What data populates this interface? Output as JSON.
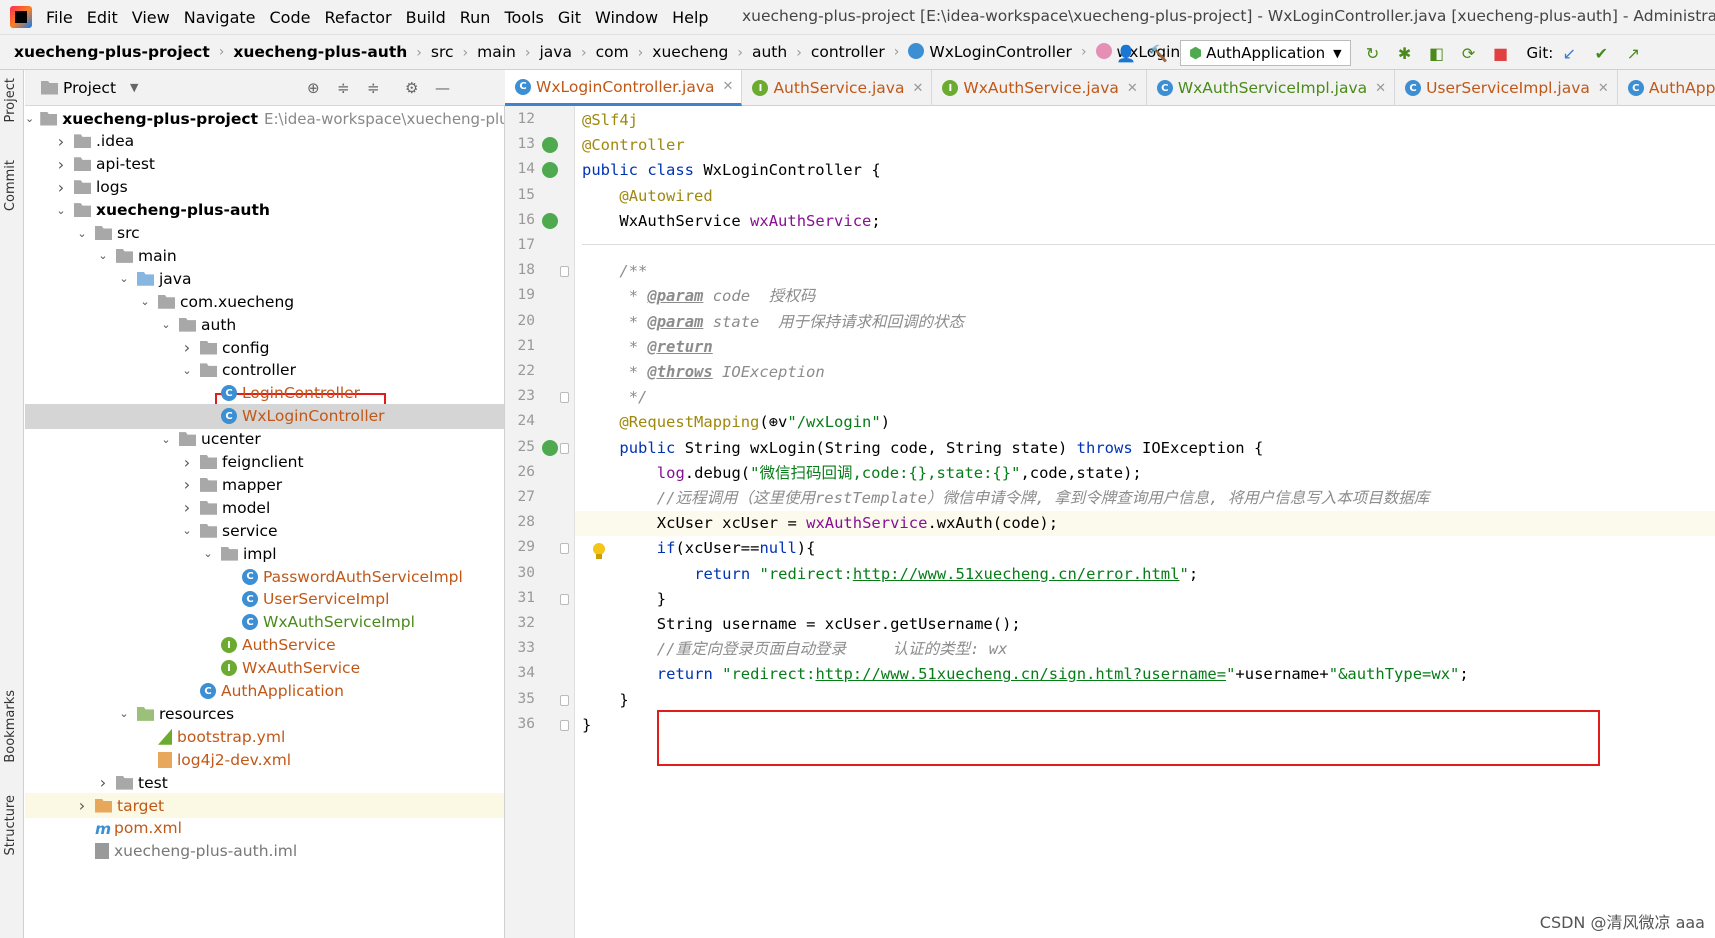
{
  "menu": [
    "File",
    "Edit",
    "View",
    "Navigate",
    "Code",
    "Refactor",
    "Build",
    "Run",
    "Tools",
    "Git",
    "Window",
    "Help"
  ],
  "window_title": "xuecheng-plus-project [E:\\idea-workspace\\xuecheng-plus-project] - WxLoginController.java [xuecheng-plus-auth] - Administrator",
  "breadcrumb": {
    "project": "xuecheng-plus-project",
    "module": "xuecheng-plus-auth",
    "path": [
      "src",
      "main",
      "java",
      "com",
      "xuecheng",
      "auth",
      "controller"
    ],
    "class": "WxLoginController",
    "method": "wxLogin"
  },
  "toolbar": {
    "run_config": "AuthApplication",
    "git_label": "Git:"
  },
  "side_tabs": {
    "project": "Project",
    "commit": "Commit",
    "bookmarks": "Bookmarks",
    "structure": "Structure"
  },
  "project_panel": {
    "title": "Project"
  },
  "tree": [
    {
      "label": "xuecheng-plus-project",
      "path": "E:\\idea-workspace\\xuecheng-plu",
      "depth": 0,
      "chev": "v",
      "icon": "folder",
      "style": "bold"
    },
    {
      "label": ".idea",
      "depth": 1,
      "chev": ">",
      "icon": "folder"
    },
    {
      "label": "api-test",
      "depth": 1,
      "chev": ">",
      "icon": "folder"
    },
    {
      "label": "logs",
      "depth": 1,
      "chev": ">",
      "icon": "folder"
    },
    {
      "label": "xuecheng-plus-auth",
      "depth": 1,
      "chev": "v",
      "icon": "folder",
      "style": "bold"
    },
    {
      "label": "src",
      "depth": 2,
      "chev": "v",
      "icon": "folder"
    },
    {
      "label": "main",
      "depth": 3,
      "chev": "v",
      "icon": "folder"
    },
    {
      "label": "java",
      "depth": 4,
      "chev": "v",
      "icon": "folder-blue"
    },
    {
      "label": "com.xuecheng",
      "depth": 5,
      "chev": "v",
      "icon": "folder"
    },
    {
      "label": "auth",
      "depth": 6,
      "chev": "v",
      "icon": "folder"
    },
    {
      "label": "config",
      "depth": 7,
      "chev": ">",
      "icon": "folder"
    },
    {
      "label": "controller",
      "depth": 7,
      "chev": "v",
      "icon": "folder"
    },
    {
      "label": "LoginController",
      "depth": 8,
      "chev": "",
      "icon": "class",
      "style": "orange"
    },
    {
      "label": "WxLoginController",
      "depth": 8,
      "chev": "",
      "icon": "class",
      "style": "orange",
      "selected": true
    },
    {
      "label": "ucenter",
      "depth": 6,
      "chev": "v",
      "icon": "folder"
    },
    {
      "label": "feignclient",
      "depth": 7,
      "chev": ">",
      "icon": "folder"
    },
    {
      "label": "mapper",
      "depth": 7,
      "chev": ">",
      "icon": "folder"
    },
    {
      "label": "model",
      "depth": 7,
      "chev": ">",
      "icon": "folder"
    },
    {
      "label": "service",
      "depth": 7,
      "chev": "v",
      "icon": "folder"
    },
    {
      "label": "impl",
      "depth": 8,
      "chev": "v",
      "icon": "folder"
    },
    {
      "label": "PasswordAuthServiceImpl",
      "depth": 9,
      "chev": "",
      "icon": "class",
      "style": "orange"
    },
    {
      "label": "UserServiceImpl",
      "depth": 9,
      "chev": "",
      "icon": "class",
      "style": "orange"
    },
    {
      "label": "WxAuthServiceImpl",
      "depth": 9,
      "chev": "",
      "icon": "class",
      "style": "green"
    },
    {
      "label": "AuthService",
      "depth": 8,
      "chev": "",
      "icon": "interface",
      "style": "orange"
    },
    {
      "label": "WxAuthService",
      "depth": 8,
      "chev": "",
      "icon": "interface",
      "style": "orange"
    },
    {
      "label": "AuthApplication",
      "depth": 7,
      "chev": "",
      "icon": "class",
      "style": "orange"
    },
    {
      "label": "resources",
      "depth": 4,
      "chev": "v",
      "icon": "folder-res"
    },
    {
      "label": "bootstrap.yml",
      "depth": 5,
      "chev": "",
      "icon": "yml",
      "style": "orange"
    },
    {
      "label": "log4j2-dev.xml",
      "depth": 5,
      "chev": "",
      "icon": "xml",
      "style": "orange"
    },
    {
      "label": "test",
      "depth": 3,
      "chev": ">",
      "icon": "folder"
    },
    {
      "label": "target",
      "depth": 2,
      "chev": ">",
      "icon": "folder-orange",
      "style": "orange",
      "highlight": true
    },
    {
      "label": "pom.xml",
      "depth": 2,
      "chev": "",
      "icon": "pom",
      "style": "orange"
    },
    {
      "label": "xuecheng-plus-auth.iml",
      "depth": 2,
      "chev": "",
      "icon": "iml",
      "style": "grey"
    }
  ],
  "editor_tabs": [
    {
      "label": "WxLoginController.java",
      "icon": "c",
      "active": true,
      "color": "orange"
    },
    {
      "label": "AuthService.java",
      "icon": "i",
      "active": false,
      "color": "orange"
    },
    {
      "label": "WxAuthService.java",
      "icon": "i",
      "active": false,
      "color": "orange"
    },
    {
      "label": "WxAuthServiceImpl.java",
      "icon": "c",
      "active": false,
      "color": "green"
    },
    {
      "label": "UserServiceImpl.java",
      "icon": "c",
      "active": false,
      "color": "orange"
    },
    {
      "label": "AuthApplicatio",
      "icon": "c",
      "active": false,
      "color": "orange"
    }
  ],
  "code": [
    {
      "n": "12",
      "indent": 0,
      "parts": [
        [
          "ann",
          "@Slf4j"
        ]
      ]
    },
    {
      "n": "13",
      "indent": 0,
      "mark": "bean",
      "parts": [
        [
          "ann",
          "@Controller"
        ]
      ]
    },
    {
      "n": "14",
      "indent": 0,
      "mark": "bean",
      "parts": [
        [
          "kw",
          "public class "
        ],
        [
          "",
          "WxLoginController "
        ],
        [
          "",
          "{"
        ]
      ]
    },
    {
      "n": "15",
      "indent": 1,
      "parts": [
        [
          "ann",
          "@Autowired"
        ]
      ]
    },
    {
      "n": "16",
      "indent": 1,
      "mark": "bean",
      "parts": [
        [
          "",
          "WxAuthService "
        ],
        [
          "fld",
          "wxAuthService"
        ],
        [
          "",
          ";"
        ]
      ]
    },
    {
      "n": "17",
      "indent": 0,
      "parts": [],
      "separator": true
    },
    {
      "n": "18",
      "indent": 1,
      "fold": true,
      "parts": [
        [
          "doc",
          "/**"
        ]
      ]
    },
    {
      "n": "19",
      "indent": 1,
      "parts": [
        [
          "doc",
          " * "
        ],
        [
          "doctag",
          "@param"
        ],
        [
          "doc",
          " code  授权码"
        ]
      ]
    },
    {
      "n": "20",
      "indent": 1,
      "parts": [
        [
          "doc",
          " * "
        ],
        [
          "doctag",
          "@param"
        ],
        [
          "doc",
          " state  用于保持请求和回调的状态"
        ]
      ]
    },
    {
      "n": "21",
      "indent": 1,
      "parts": [
        [
          "doc",
          " * "
        ],
        [
          "doctag",
          "@return"
        ]
      ]
    },
    {
      "n": "22",
      "indent": 1,
      "parts": [
        [
          "doc",
          " * "
        ],
        [
          "doctag",
          "@throws"
        ],
        [
          "doc",
          " IOException"
        ]
      ]
    },
    {
      "n": "23",
      "indent": 1,
      "fold": true,
      "parts": [
        [
          "doc",
          " */"
        ]
      ]
    },
    {
      "n": "24",
      "indent": 1,
      "parts": [
        [
          "ann",
          "@RequestMapping"
        ],
        [
          "",
          "(⊕v"
        ],
        [
          "str",
          "\"/wxLogin\""
        ],
        [
          "",
          ")"
        ]
      ]
    },
    {
      "n": "25",
      "indent": 1,
      "mark": "bean",
      "fold": true,
      "parts": [
        [
          "kw",
          "public "
        ],
        [
          "",
          "String wxLogin(String code, String state) "
        ],
        [
          "kw",
          "throws "
        ],
        [
          "",
          "IOException {"
        ]
      ]
    },
    {
      "n": "26",
      "indent": 2,
      "parts": [
        [
          "fld",
          "log"
        ],
        [
          "",
          ".debug("
        ],
        [
          "str",
          "\"微信扫码回调,code:{},state:{}\""
        ],
        [
          "",
          ",code,state);"
        ]
      ]
    },
    {
      "n": "27",
      "indent": 2,
      "parts": [
        [
          "cmt",
          "//远程调用（这里使用restTemplate）微信申请令牌, 拿到令牌查询用户信息, 将用户信息写入本项目数据库"
        ]
      ]
    },
    {
      "n": "28",
      "indent": 2,
      "current": true,
      "parts": [
        [
          "",
          "XcUser xcUser = "
        ],
        [
          "fld",
          "wxAuthService"
        ],
        [
          "",
          ".wxAuth(code);"
        ]
      ]
    },
    {
      "n": "29",
      "indent": 2,
      "fold": true,
      "parts": [
        [
          "kw",
          "if"
        ],
        [
          "",
          "(xcUser=="
        ],
        [
          "kw",
          "null"
        ],
        [
          "",
          "){"
        ]
      ]
    },
    {
      "n": "30",
      "indent": 3,
      "parts": [
        [
          "kw",
          "return "
        ],
        [
          "str",
          "\"redirect:http://www.51xuecheng.cn/error.html\""
        ],
        [
          "",
          ";"
        ]
      ]
    },
    {
      "n": "31",
      "indent": 2,
      "fold": true,
      "parts": [
        [
          "",
          "}"
        ]
      ]
    },
    {
      "n": "32",
      "indent": 2,
      "parts": [
        [
          "",
          "String username = xcUser.getUsername();"
        ]
      ]
    },
    {
      "n": "33",
      "indent": 2,
      "parts": [
        [
          "cmt",
          "//重定向登录页面自动登录     认证的类型: wx"
        ]
      ]
    },
    {
      "n": "34",
      "indent": 2,
      "parts": [
        [
          "kw",
          "return "
        ],
        [
          "str",
          "\"redirect:http://www.51xuecheng.cn/sign.html?username=\""
        ],
        [
          "",
          "+username+"
        ],
        [
          "str",
          "\"&authType=wx\""
        ],
        [
          "",
          ";"
        ]
      ]
    },
    {
      "n": "35",
      "indent": 1,
      "fold": true,
      "parts": [
        [
          "",
          "}"
        ]
      ]
    },
    {
      "n": "36",
      "indent": 0,
      "fold": true,
      "parts": [
        [
          "",
          "}"
        ]
      ]
    }
  ],
  "watermark": "CSDN @清风微凉 aaa"
}
